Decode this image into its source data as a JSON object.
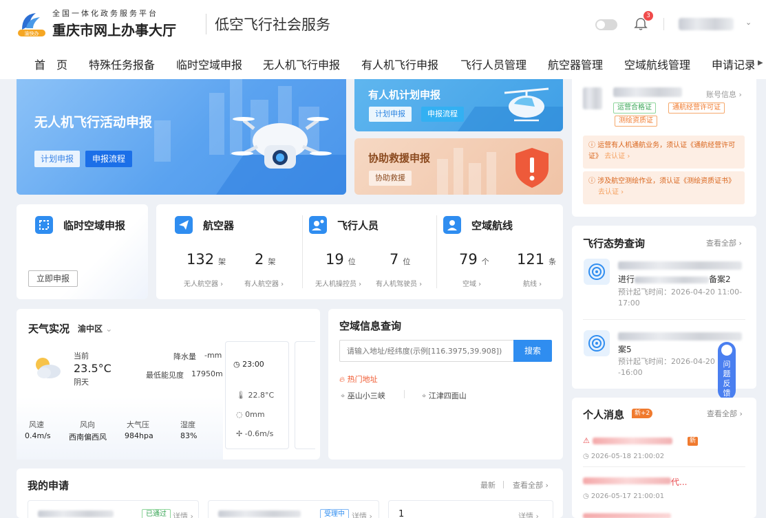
{
  "header": {
    "logo_sub": "全国一体化政务服务平台",
    "logo_main": "重庆市网上办事大厅",
    "logo_badge": "渝快办",
    "service_title": "低空飞行社会服务",
    "notification_count": "3",
    "user_chevron": "⌄"
  },
  "nav": {
    "items": [
      "首　页",
      "特殊任务报备",
      "临时空域申报",
      "无人机飞行申报",
      "有人机飞行申报",
      "飞行人员管理",
      "航空器管理",
      "空域航线管理",
      "申请记录"
    ],
    "arrow": "▶"
  },
  "banners": {
    "uav": {
      "title": "无人机飞行活动申报",
      "btn_plan": "计划申报",
      "btn_flow": "申报流程"
    },
    "manned": {
      "title": "有人机计划申报",
      "btn_plan": "计划申报",
      "btn_flow": "申报流程"
    },
    "rescue": {
      "title": "协助救援申报",
      "btn": "协助救援"
    }
  },
  "account": {
    "info_link": "账号信息 ›",
    "tag_green": "运营合格证",
    "tag_permit": "通航经营许可证",
    "tag_survey": "测绘资质证",
    "notice1_text": "运营有人机通航业务，须认证《通航经营许可证》",
    "notice1_link": "去认证 ›",
    "notice2_text": "涉及航空测绘作业，须认证《测绘资质证书》",
    "notice2_link": "去认证 ›"
  },
  "stats": {
    "airspace": {
      "title": "临时空域申报",
      "btn": "立即申报"
    },
    "aircraft": {
      "title": "航空器",
      "n1": "132",
      "u1": "架",
      "c1": "无人航空器 ›",
      "n2": "2",
      "u2": "架",
      "c2": "有人航空器 ›"
    },
    "pilots": {
      "title": "飞行人员",
      "n1": "19",
      "u1": "位",
      "c1": "无人机操控员 ›",
      "n2": "7",
      "u2": "位",
      "c2": "有人机驾驶员 ›"
    },
    "routes": {
      "title": "空域航线",
      "n1": "79",
      "u1": "个",
      "c1": "空域 ›",
      "n2": "121",
      "u2": "条",
      "c2": "航线 ›"
    }
  },
  "weather": {
    "title": "天气实况",
    "district": "渝中区",
    "current_label": "当前",
    "temp": "23.5°C",
    "condition": "阴天",
    "rain_label": "降水量",
    "rain_value": "-mm",
    "vis_label": "最低能见度",
    "vis_value": "17950m",
    "time": "23:00",
    "hour_temp": "22.8°C",
    "hour_rain": "0mm",
    "hour_wind": "-0.6m/s",
    "metrics": [
      {
        "label": "风速",
        "value": "0.4m/s"
      },
      {
        "label": "风向",
        "value": "西南偏西风"
      },
      {
        "label": "大气压",
        "value": "984hpa"
      },
      {
        "label": "湿度",
        "value": "83%"
      }
    ]
  },
  "airspace_query": {
    "title": "空域信息查询",
    "placeholder": "请输入地址/经纬度(示例[116.3975,39.908])",
    "search_btn": "搜索",
    "hot_label": "热门地址",
    "hot1": "巫山小三峡",
    "hot2": "江津四面山"
  },
  "flight_status": {
    "title": "飞行态势查询",
    "view_all": "查看全部 ›",
    "item1_line2": "进行",
    "item1_tail": "备案2",
    "item1_time": "预计起飞时间：2026-04-20 11:00-17:00",
    "item2_line2": "案5",
    "item2_time": "预计起飞时间：2026-04-20 -16:00"
  },
  "messages": {
    "title": "个人消息",
    "badge": "新+2",
    "view_all": "查看全部 ›",
    "item1_time": "2026-05-18 21:00:02",
    "item2_tail": "代...",
    "item2_time": "2026-05-17 21:00:01",
    "new_tag": "新"
  },
  "my_apps": {
    "title": "我的申请",
    "latest": "最新",
    "view_all": "查看全部 ›",
    "status_passed": "已通过",
    "status_processing": "受理中",
    "detail": "详情 ›",
    "third_num": "1"
  },
  "feedback": {
    "text": "问题反馈"
  },
  "colors": {
    "primary": "#1b6fe8",
    "accent_orange": "#f07a2e",
    "feedback": "#4a7ff0"
  }
}
